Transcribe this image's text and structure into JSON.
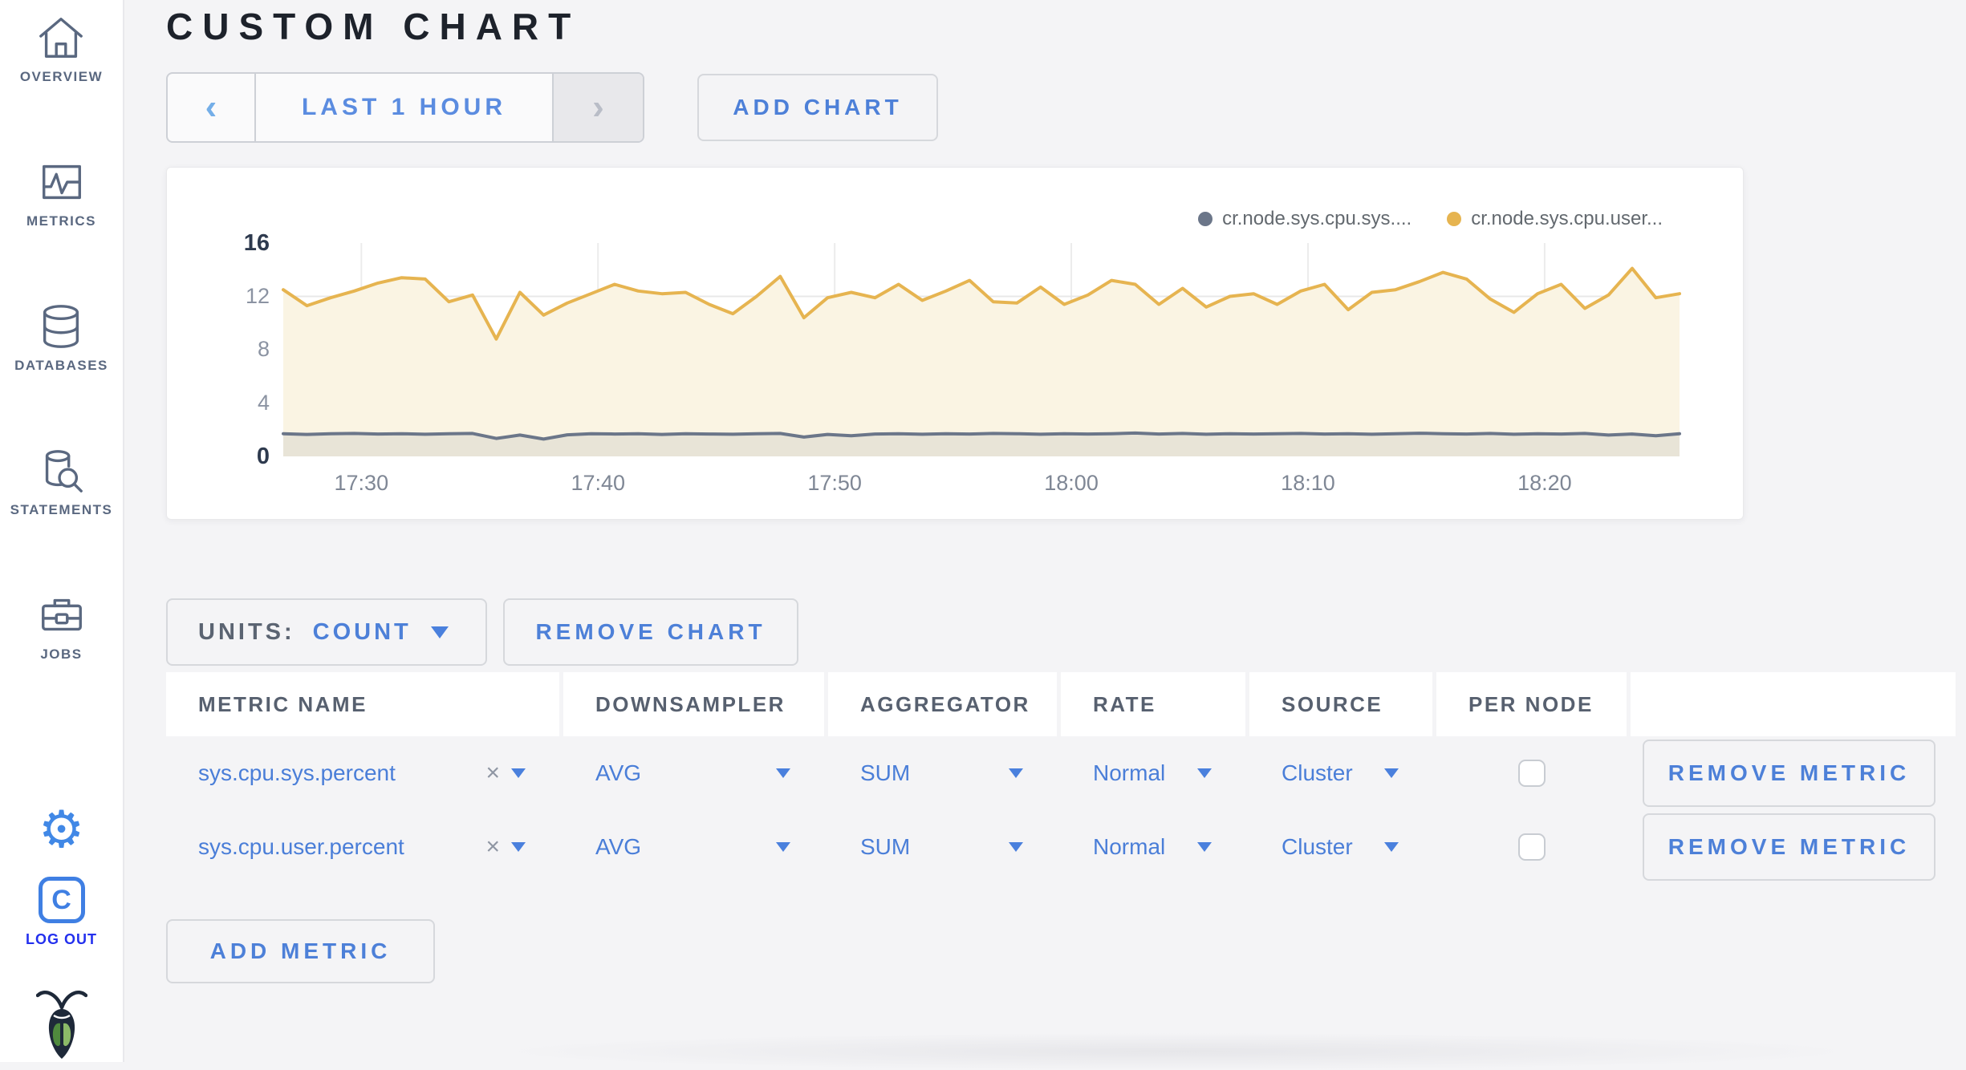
{
  "sidebar": {
    "items": [
      {
        "label": "OVERVIEW",
        "icon": "home-icon"
      },
      {
        "label": "METRICS",
        "icon": "metrics-icon"
      },
      {
        "label": "DATABASES",
        "icon": "database-icon"
      },
      {
        "label": "STATEMENTS",
        "icon": "statements-search-icon"
      },
      {
        "label": "JOBS",
        "icon": "briefcase-icon"
      }
    ],
    "gear_icon": "⚙",
    "logout": {
      "logo_letter": "C",
      "label": "LOG OUT"
    }
  },
  "header": {
    "title": "CUSTOM CHART"
  },
  "toolbar": {
    "prev_icon": "‹",
    "time_range": "LAST 1 HOUR",
    "next_icon": "›",
    "add_chart_label": "ADD CHART"
  },
  "chart_data": {
    "type": "line",
    "title": "",
    "xlabel": "",
    "ylabel": "",
    "ylim": [
      0,
      16
    ],
    "y_ticks": [
      0,
      4,
      8,
      12,
      16
    ],
    "x_domain": [
      0,
      59
    ],
    "x_ticks": [
      {
        "min": 3.3,
        "label": "17:30"
      },
      {
        "min": 13.3,
        "label": "17:40"
      },
      {
        "min": 23.3,
        "label": "17:50"
      },
      {
        "min": 33.3,
        "label": "18:00"
      },
      {
        "min": 43.3,
        "label": "18:10"
      },
      {
        "min": 53.3,
        "label": "18:20"
      }
    ],
    "grid": true,
    "legend_position": "top-right",
    "series": [
      {
        "name": "cr.node.sys.cpu.sys....",
        "color": "#6b7689",
        "fill": "rgba(106,116,131,0.12)",
        "values": [
          1.7,
          1.65,
          1.7,
          1.72,
          1.68,
          1.7,
          1.66,
          1.7,
          1.72,
          1.35,
          1.6,
          1.3,
          1.62,
          1.7,
          1.68,
          1.7,
          1.65,
          1.7,
          1.68,
          1.66,
          1.7,
          1.72,
          1.45,
          1.65,
          1.55,
          1.68,
          1.7,
          1.66,
          1.7,
          1.68,
          1.72,
          1.7,
          1.66,
          1.7,
          1.68,
          1.7,
          1.75,
          1.68,
          1.72,
          1.66,
          1.7,
          1.68,
          1.7,
          1.72,
          1.68,
          1.7,
          1.66,
          1.7,
          1.74,
          1.7,
          1.68,
          1.72,
          1.66,
          1.7,
          1.68,
          1.72,
          1.6,
          1.68,
          1.55,
          1.7
        ]
      },
      {
        "name": "cr.node.sys.cpu.user...",
        "color": "#e6b450",
        "fill": "#faf4e3",
        "values": [
          12.5,
          11.3,
          11.9,
          12.4,
          13.0,
          13.4,
          13.3,
          11.6,
          12.1,
          8.8,
          12.3,
          10.6,
          11.5,
          12.2,
          12.9,
          12.4,
          12.2,
          12.3,
          11.4,
          10.7,
          12.0,
          13.5,
          10.4,
          11.9,
          12.3,
          11.9,
          12.9,
          11.7,
          12.4,
          13.2,
          11.6,
          11.5,
          12.7,
          11.4,
          12.1,
          13.2,
          12.9,
          11.4,
          12.6,
          11.2,
          12.0,
          12.2,
          11.4,
          12.4,
          12.9,
          11.0,
          12.3,
          12.5,
          13.1,
          13.8,
          13.3,
          11.8,
          10.8,
          12.2,
          12.9,
          11.1,
          12.1,
          14.1,
          11.9,
          12.2
        ]
      }
    ]
  },
  "controls": {
    "units_label": "UNITS:",
    "units_value": "COUNT",
    "remove_chart_label": "REMOVE CHART"
  },
  "table": {
    "headers": [
      "METRIC NAME",
      "DOWNSAMPLER",
      "AGGREGATOR",
      "RATE",
      "SOURCE",
      "PER NODE",
      ""
    ],
    "rows": [
      {
        "metric": "sys.cpu.sys.percent",
        "close_icon": "×",
        "downsampler": "AVG",
        "aggregator": "SUM",
        "rate": "Normal",
        "source": "Cluster",
        "per_node_checked": false,
        "remove_label": "REMOVE METRIC"
      },
      {
        "metric": "sys.cpu.user.percent",
        "close_icon": "×",
        "downsampler": "AVG",
        "aggregator": "SUM",
        "rate": "Normal",
        "source": "Cluster",
        "per_node_checked": false,
        "remove_label": "REMOVE METRIC"
      }
    ]
  },
  "add_metric_label": "ADD METRIC"
}
